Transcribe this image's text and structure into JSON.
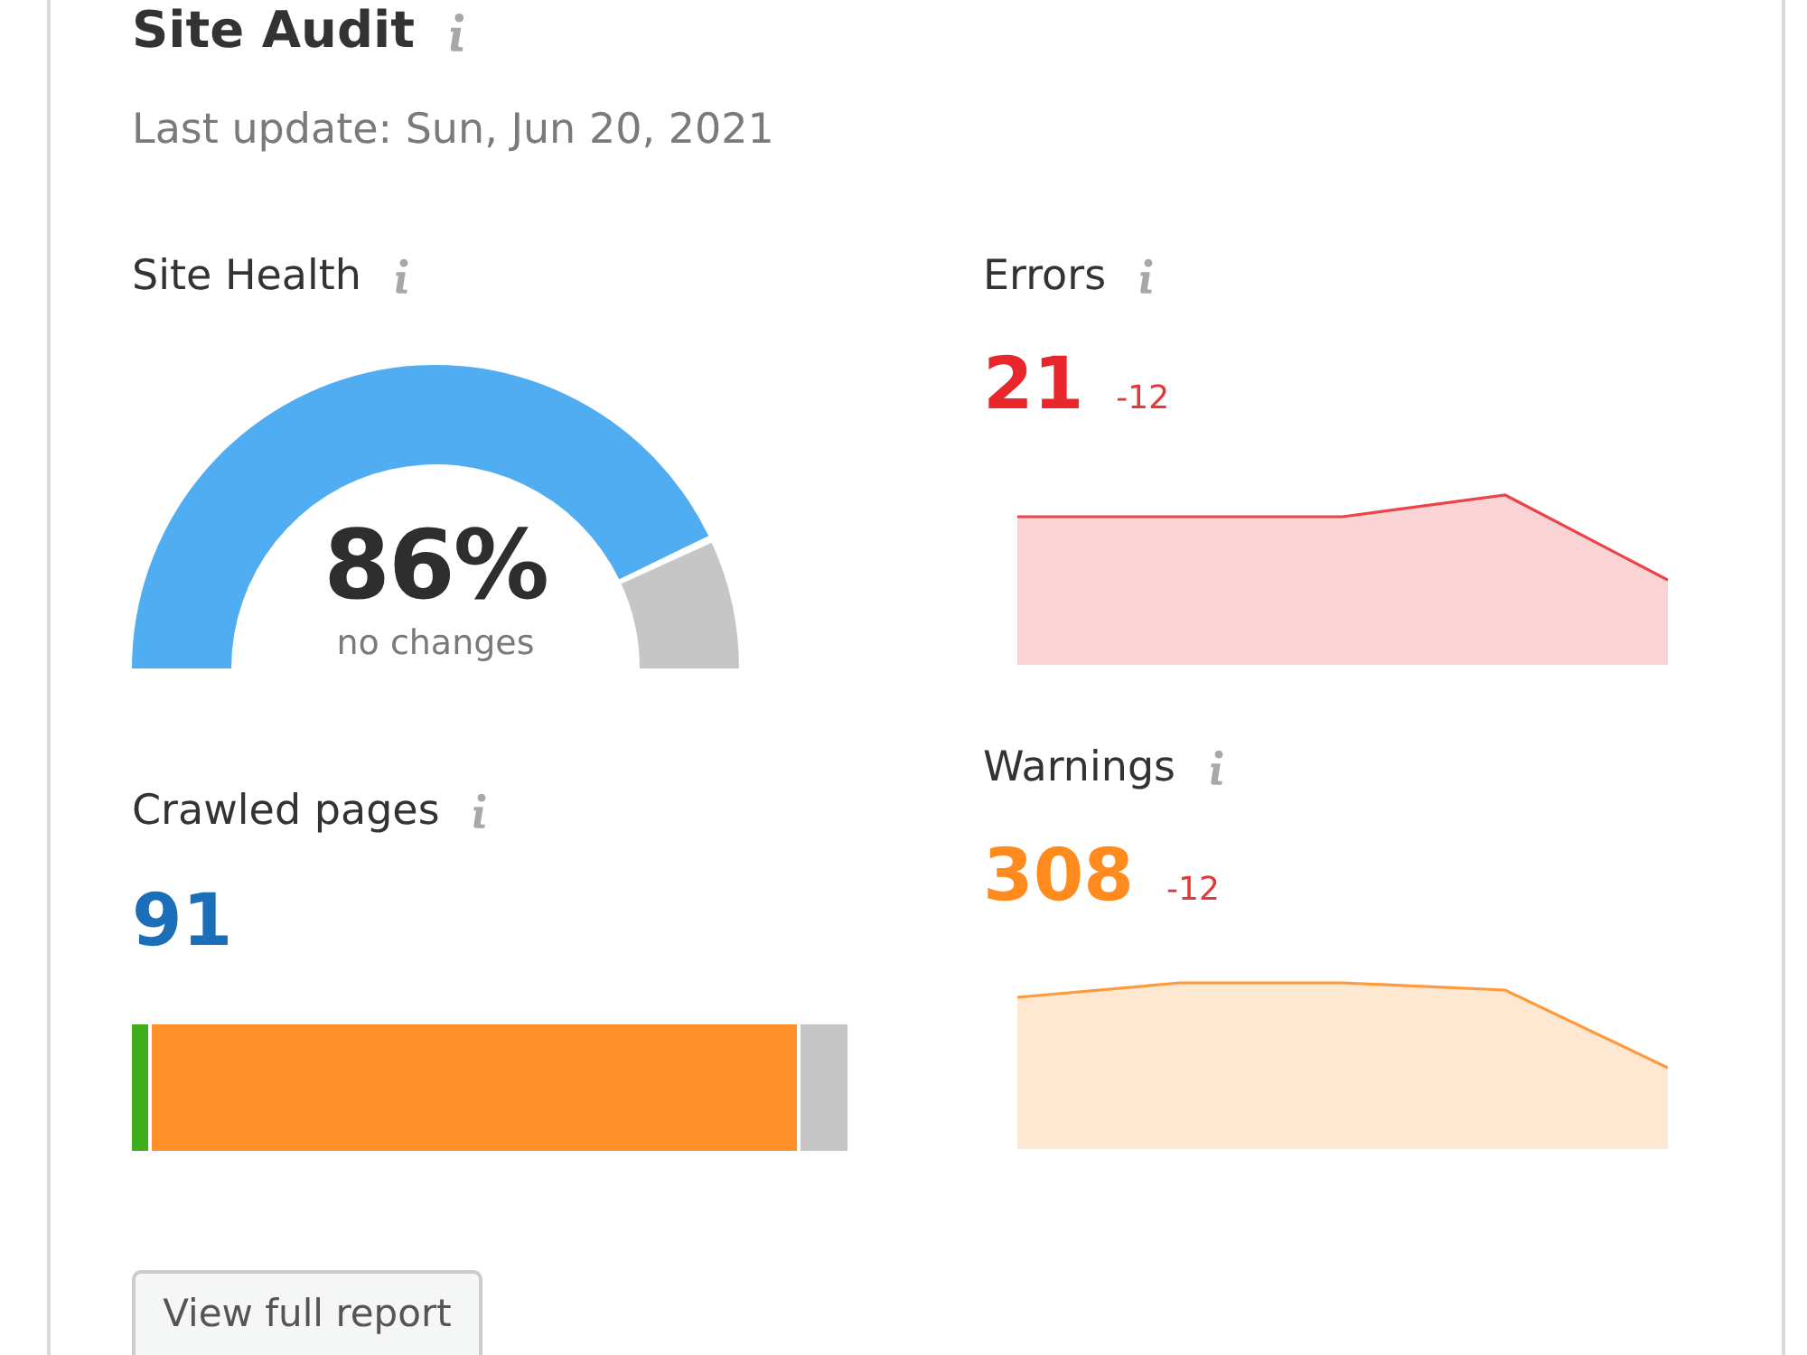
{
  "card": {
    "title": "Site Audit",
    "last_update": "Last update: Sun, Jun 20, 2021"
  },
  "site_health": {
    "label": "Site Health",
    "value": "86%",
    "note": "no changes",
    "chart_data": [
      {
        "type": "donut",
        "values": [
          86,
          14
        ],
        "colors": [
          "#50adf2",
          "#c6c6c6"
        ]
      }
    ]
  },
  "metrics": [
    {
      "label": "Errors",
      "value": "21",
      "change": "-12",
      "color": "#e8262b"
    },
    {
      "label": "Warnings",
      "value": "308",
      "change": "-12",
      "color": "#ff8a1d"
    }
  ],
  "crawled_pages": {
    "label": "Crawled pages",
    "value": "91"
  },
  "button": "View full report"
}
